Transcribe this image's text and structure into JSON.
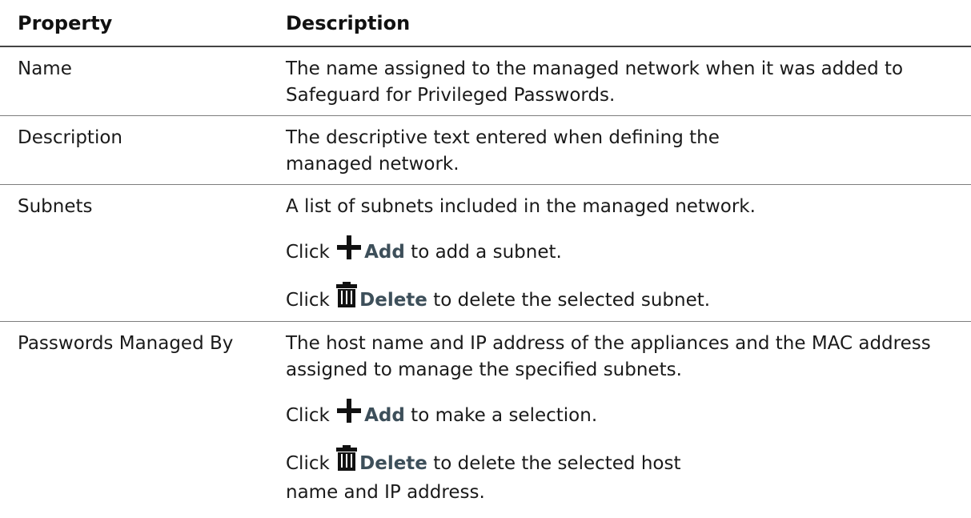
{
  "headers": {
    "property": "Property",
    "description": "Description"
  },
  "rows": [
    {
      "property": "Name",
      "description": "The name assigned to the managed network when it was added to Safeguard for Privileged Passwords."
    },
    {
      "property": "Description",
      "description": "The descriptive text entered when defining the managed network."
    },
    {
      "property": "Subnets",
      "description": "A list of subnets included in the managed network.",
      "add_click": "Click",
      "add_label": "Add",
      "add_suffix": "to add a subnet.",
      "delete_click": "Click",
      "delete_label": "Delete",
      "delete_suffix": "to delete the selected subnet."
    },
    {
      "property": "Passwords Managed By",
      "description": "The host name and IP address of the appliances and the MAC address assigned to manage the specified subnets.",
      "add_click": "Click",
      "add_label": "Add",
      "add_suffix": "to make a selection.",
      "delete_click": "Click",
      "delete_label": "Delete",
      "delete_suffix": "to delete the selected host name and IP address."
    }
  ],
  "icons": {
    "add": "plus-icon",
    "delete": "trash-icon"
  }
}
